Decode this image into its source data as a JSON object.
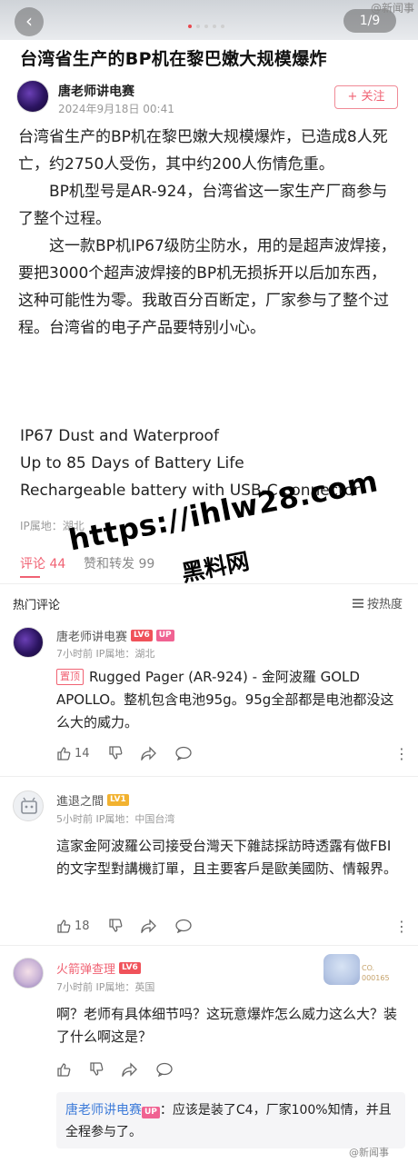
{
  "header": {
    "page_counter": "1/9",
    "watermark_top": "@新闻事"
  },
  "post": {
    "title": "台湾省生产的BP机在黎巴嫩大规模爆炸",
    "author": "唐老师讲电赛",
    "date": "2024年9月18日 00:41",
    "follow_label": "+ 关注",
    "para1": "台湾省生产的BP机在黎巴嫩大规模爆炸，已造成8人死亡，约2750人受伤，其中约200人伤情危重。",
    "para2": "BP机型号是AR-924，台湾省这一家生产厂商参与了整个过程。",
    "para3": "这一款BP机IP67级防尘防水，用的是超声波焊接，要把3000个超声波焊接的BP机无损拆开以后加东西，这种可能性为零。我敢百分百断定，厂家参与了整个过程。台湾省的电子产品要特别小心。",
    "eng1": "IP67 Dust and Waterproof",
    "eng2": "Up to 85 Days of Battery Life",
    "eng3": "Rechargeable battery with USB-C connector",
    "ip_location": "IP属地：湖北"
  },
  "tabs": {
    "comments": "评论 44",
    "reposts": "赞和转发 99"
  },
  "overlay_watermark": {
    "url": "https://ihlw28.com",
    "text": "黑料网"
  },
  "comments_section": {
    "title": "热门评论",
    "sort_label": "按热度"
  },
  "comments": [
    {
      "name": "唐老师讲电赛",
      "level": "LV6",
      "badge": "UP",
      "meta": "7小时前  IP属地：湖北",
      "pin_label": "置顶",
      "text": "Rugged Pager (AR-924) - 金阿波羅 GOLD APOLLO。整机包含电池95g。95g全部都是电池都没这么大的威力。",
      "likes": "14"
    },
    {
      "name": "進退之間",
      "level": "LV1",
      "meta": "5小时前  IP属地：中国台湾",
      "text": "這家金阿波羅公司接受台灣天下雜誌採訪時透露有做FBI的文字型對講機訂單，且主要客戶是歐美國防、情報界。",
      "likes": "18"
    },
    {
      "name": "火箭弹查理",
      "level": "LV6",
      "meta": "7小时前  IP属地：英国",
      "text": "啊？老师有具体细节吗？这玩意爆炸怎么威力这么大？装了什么啊这是？",
      "deco_badge_line1": "CO.",
      "deco_badge_line2": "000165"
    }
  ],
  "reply": {
    "author": "唐老师讲电赛",
    "badge": "UP",
    "text": "：应该是装了C4，厂家100%知情，并且全程参与了。"
  },
  "footer": {
    "watermark_bottom": "@新闻事"
  }
}
